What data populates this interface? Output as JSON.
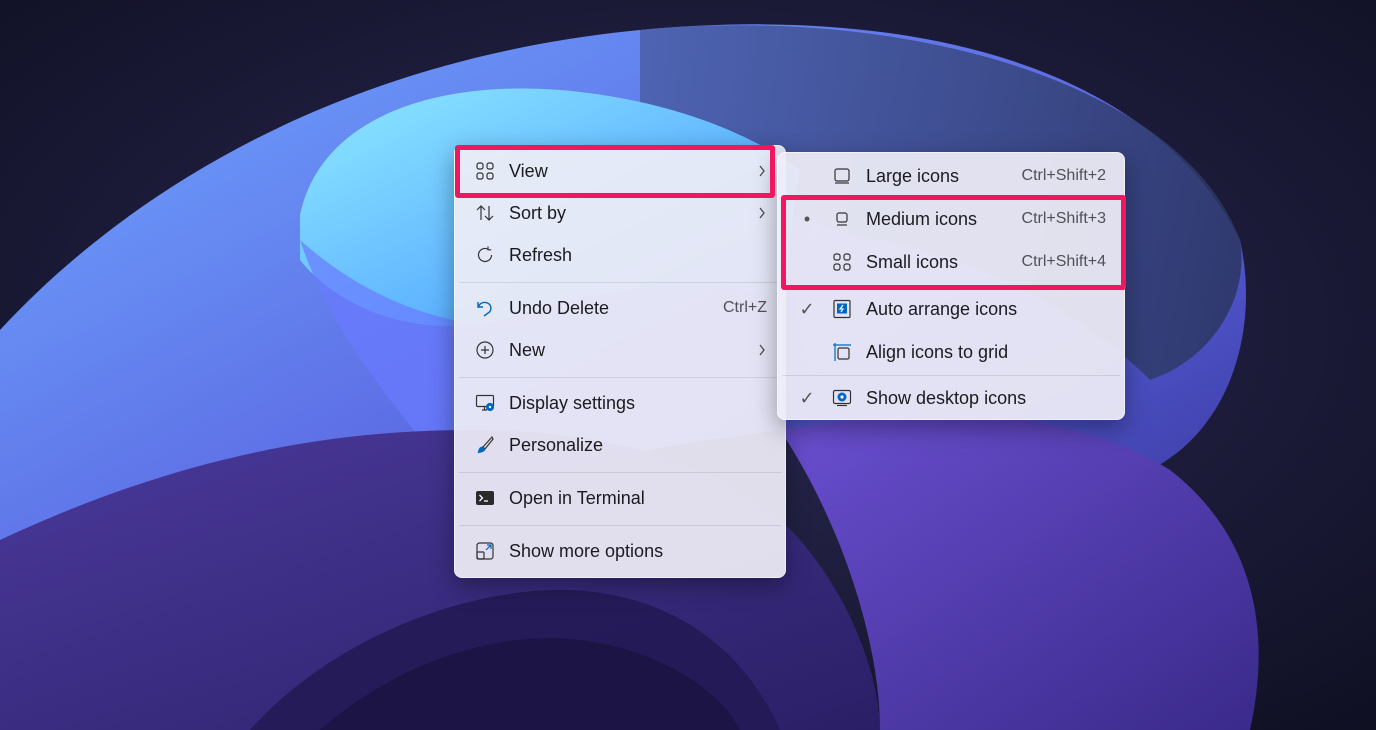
{
  "context_menu": {
    "items": [
      {
        "label": "View",
        "icon": "grid-view-icon"
      },
      {
        "label": "Sort by",
        "icon": "sort-arrows-icon"
      },
      {
        "label": "Refresh",
        "icon": "refresh-icon"
      },
      {
        "label": "Undo Delete",
        "shortcut": "Ctrl+Z",
        "icon": "undo-icon"
      },
      {
        "label": "New",
        "icon": "plus-circle-icon"
      },
      {
        "label": "Display settings",
        "icon": "display-settings-icon"
      },
      {
        "label": "Personalize",
        "icon": "brush-icon"
      },
      {
        "label": "Open in Terminal",
        "icon": "terminal-icon"
      },
      {
        "label": "Show more options",
        "icon": "expand-icon"
      }
    ]
  },
  "view_submenu": {
    "items": [
      {
        "label": "Large icons",
        "shortcut": "Ctrl+Shift+2",
        "icon": "large-icons-icon",
        "state": ""
      },
      {
        "label": "Medium icons",
        "shortcut": "Ctrl+Shift+3",
        "icon": "medium-icons-icon",
        "state": "•"
      },
      {
        "label": "Small icons",
        "shortcut": "Ctrl+Shift+4",
        "icon": "small-icons-icon",
        "state": ""
      },
      {
        "label": "Auto arrange icons",
        "icon": "auto-arrange-icon",
        "state": "✓"
      },
      {
        "label": "Align icons to grid",
        "icon": "align-grid-icon",
        "state": ""
      },
      {
        "label": "Show desktop icons",
        "icon": "desktop-icon",
        "state": "✓"
      }
    ]
  },
  "colors": {
    "highlight_border": "#f2155f",
    "accent": "#0067c0",
    "menu_background": "#eeedf6"
  }
}
